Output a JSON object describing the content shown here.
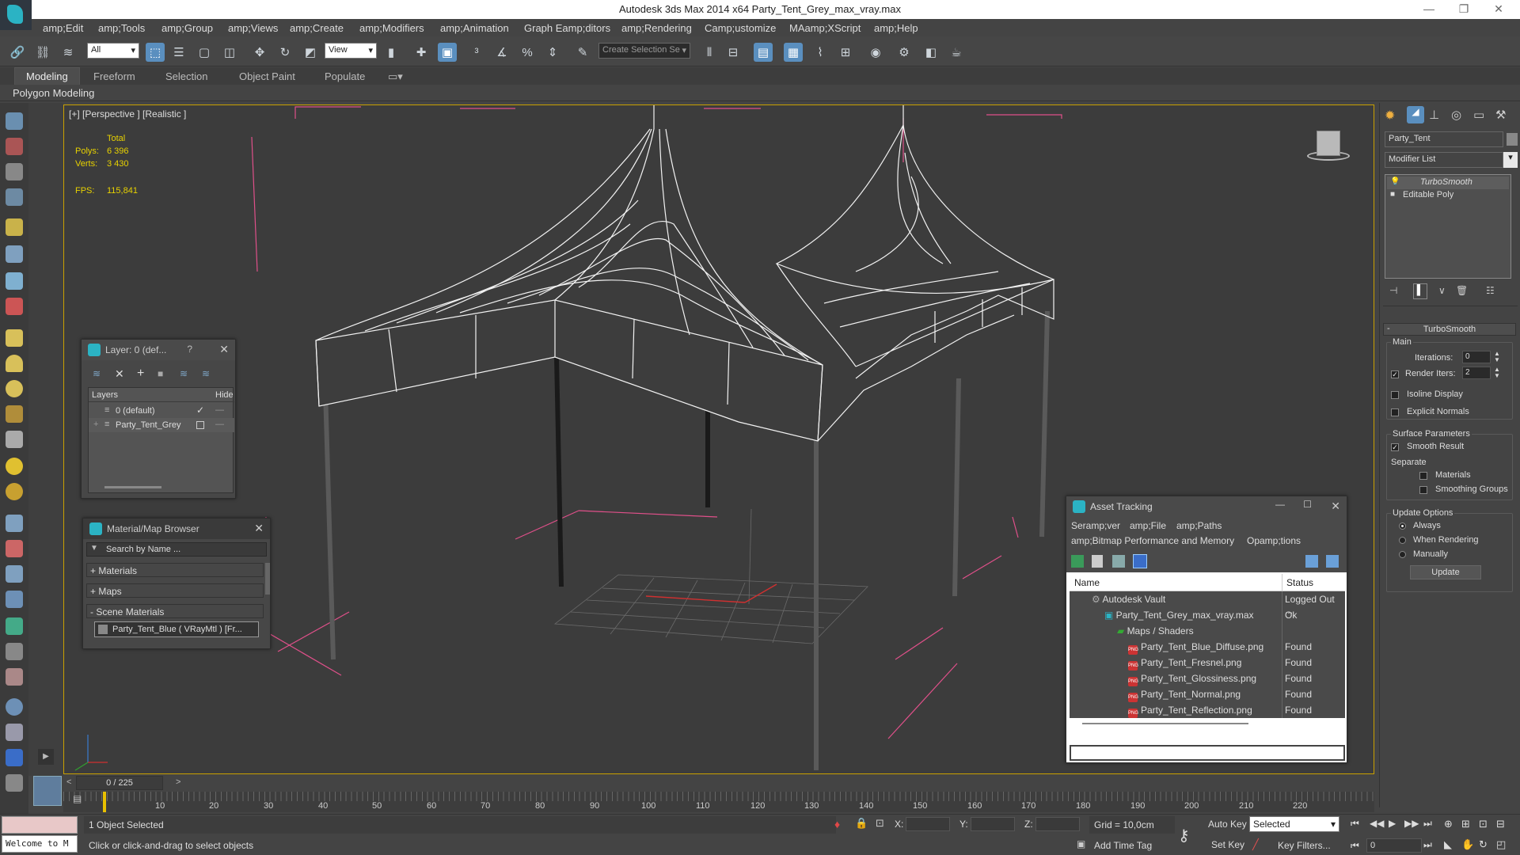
{
  "window": {
    "title": "Autodesk 3ds Max  2014 x64     Party_Tent_Grey_max_vray.max"
  },
  "menu": [
    "amp;Edit",
    "amp;Tools",
    "amp;Group",
    "amp;Views",
    "amp;Create",
    "amp;Modifiers",
    "amp;Animation",
    "Graph Eamp;ditors",
    "amp;Rendering",
    "Camp;ustomize",
    "MAamp;XScript",
    "amp;Help"
  ],
  "toolbar": {
    "selection_filter": "All",
    "ref_coord": "View",
    "named_selection_placeholder": "Create Selection Se"
  },
  "ribbon": {
    "tabs": [
      "Modeling",
      "Freeform",
      "Selection",
      "Object Paint",
      "Populate"
    ],
    "sub_label": "Polygon Modeling"
  },
  "viewport": {
    "label": "[+] [Perspective ] [Realistic ]",
    "stats": {
      "total_label": "Total",
      "polys_label": "Polys:",
      "polys_value": "6 396",
      "verts_label": "Verts:",
      "verts_value": "3 430",
      "fps_label": "FPS:",
      "fps_value": "115,841"
    }
  },
  "layer_panel": {
    "title": "Layer: 0 (def...",
    "help": "?",
    "col_layers": "Layers",
    "col_hide": "Hide",
    "rows": [
      {
        "name": "0 (default)",
        "checked": true
      },
      {
        "name": "Party_Tent_Grey",
        "checked": false
      }
    ]
  },
  "material_browser": {
    "title": "Material/Map Browser",
    "search_placeholder": "Search by Name ...",
    "sections": [
      "+ Materials",
      "+ Maps",
      "- Scene Materials"
    ],
    "scene_material": "Party_Tent_Blue  ( VRayMtl )  [Fr..."
  },
  "asset_tracking": {
    "title": "Asset Tracking",
    "menu": [
      "Seramp;ver",
      "amp;File",
      "amp;Paths"
    ],
    "menu2": [
      "amp;Bitmap Performance and Memory",
      "Opamp;tions"
    ],
    "col_name": "Name",
    "col_status": "Status",
    "rows": [
      {
        "name": "Autodesk Vault",
        "status": "Logged Out ...",
        "indent": 1,
        "icon": "vault"
      },
      {
        "name": "Party_Tent_Grey_max_vray.max",
        "status": "Ok",
        "indent": 2,
        "icon": "max"
      },
      {
        "name": "Maps / Shaders",
        "status": "",
        "indent": 3,
        "icon": "folder"
      },
      {
        "name": "Party_Tent_Blue_Diffuse.png",
        "status": "Found",
        "indent": 4,
        "icon": "png"
      },
      {
        "name": "Party_Tent_Fresnel.png",
        "status": "Found",
        "indent": 4,
        "icon": "png"
      },
      {
        "name": "Party_Tent_Glossiness.png",
        "status": "Found",
        "indent": 4,
        "icon": "png"
      },
      {
        "name": "Party_Tent_Normal.png",
        "status": "Found",
        "indent": 4,
        "icon": "png"
      },
      {
        "name": "Party_Tent_Reflection.png",
        "status": "Found",
        "indent": 4,
        "icon": "png"
      }
    ]
  },
  "command_panel": {
    "object_name": "Party_Tent",
    "modifier_list": "Modifier List",
    "stack": [
      "TurboSmooth",
      "Editable Poly"
    ],
    "rollout": "TurboSmooth",
    "main_label": "Main",
    "iterations_label": "Iterations:",
    "iterations_value": "0",
    "render_iters_label": "Render Iters:",
    "render_iters_value": "2",
    "isoline": "Isoline Display",
    "explicit_normals": "Explicit Normals",
    "surface_params": "Surface Parameters",
    "smooth_result": "Smooth Result",
    "separate": "Separate",
    "materials": "Materials",
    "smoothing_groups": "Smoothing Groups",
    "update_options": "Update Options",
    "always": "Always",
    "when_rendering": "When Rendering",
    "manually": "Manually",
    "update_btn": "Update"
  },
  "timeline": {
    "frame_readout": "0 / 225",
    "ticks": [
      "10",
      "20",
      "30",
      "40",
      "50",
      "60",
      "70",
      "80",
      "90",
      "100",
      "110",
      "120",
      "130",
      "140",
      "150",
      "160",
      "170",
      "180",
      "190",
      "200",
      "210",
      "220"
    ]
  },
  "status_bar": {
    "maxscript": "Welcome to M",
    "selected": "1 Object Selected",
    "prompt": "Click or click-and-drag to select objects",
    "x_label": "X:",
    "y_label": "Y:",
    "z_label": "Z:",
    "grid": "Grid = 10,0cm",
    "add_time_tag": "Add Time Tag",
    "auto_key": "Auto Key",
    "set_key": "Set Key",
    "key_mode": "Selected",
    "key_filters": "Key Filters...",
    "frame": "0"
  }
}
